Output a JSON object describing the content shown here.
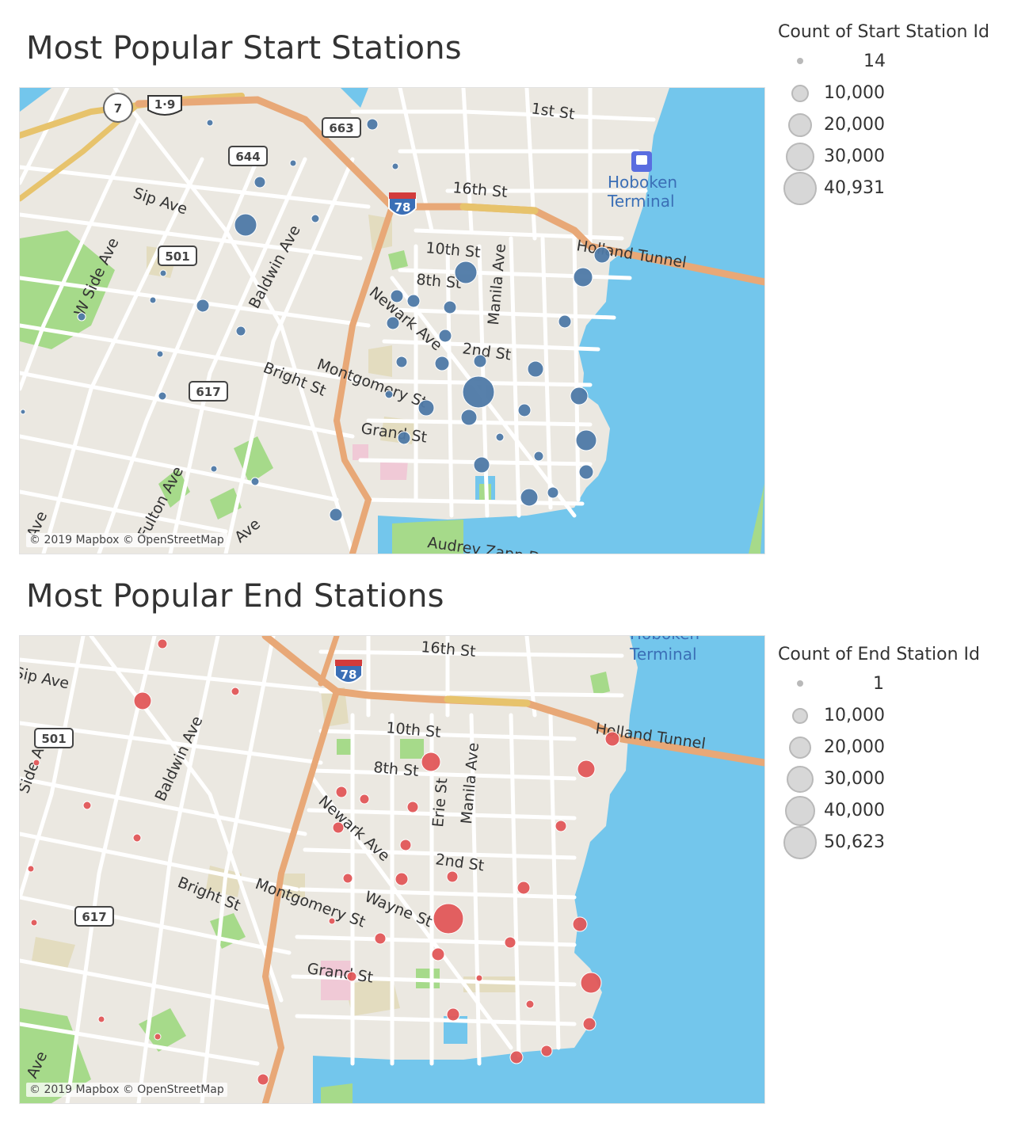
{
  "start_map": {
    "title": "Most Popular Start Stations",
    "attribution": "© 2019 Mapbox © OpenStreetMap",
    "dot_color": "#4e79a7",
    "legend": {
      "title": "Count of Start Station Id",
      "items": [
        "14",
        "10,000",
        "20,000",
        "30,000",
        "40,931"
      ]
    },
    "labels": {
      "first_st": "1st St",
      "sixteenth_st": "16th St",
      "sip_ave": "Sip Ave",
      "tenth_st": "10th St",
      "eighth_st": "8th St",
      "baldwin_ave": "Baldwin Ave",
      "manila_ave": "Manila Ave",
      "holland_tunnel": "Holland Tunnel",
      "side_ave": "W Side Ave",
      "newark_ave": "Newark Ave",
      "second_st": "2nd St",
      "bright_st": "Bright St",
      "montgomery_st": "Montgomery St",
      "grand_st": "Grand St",
      "audrey": "Audrey Zapp Dr",
      "ave_a": "Ave",
      "ave_b": "Fulton Ave",
      "ave_c": "Ave",
      "hoboken_1": "Hoboken",
      "hoboken_2": "Terminal"
    },
    "shields": {
      "s7": "7",
      "s19": "1·9",
      "s663": "663",
      "s644": "644",
      "s501": "501",
      "s617": "617",
      "s78": "78"
    }
  },
  "end_map": {
    "title": "Most Popular End Stations",
    "attribution": "© 2019 Mapbox © OpenStreetMap",
    "dot_color": "#e15759",
    "legend": {
      "title": "Count of End Station Id",
      "items": [
        "1",
        "10,000",
        "20,000",
        "30,000",
        "40,000",
        "50,623"
      ]
    },
    "labels": {
      "sip_ave": "Sip Ave",
      "sixteenth_st": "16th St",
      "tenth_st": "10th St",
      "eighth_st": "8th St",
      "baldwin_ave": "Baldwin Ave",
      "erie_st": "Erie St",
      "manila_ave": "Manila Ave",
      "holland_tunnel": "Holland Tunnel",
      "newark_ave": "Newark Ave",
      "second_st": "2nd St",
      "wayne_st": "Wayne St",
      "bright_st": "Bright St",
      "montgomery_st": "Montgomery St",
      "grand_st": "Grand St",
      "side_ave": "Side Ave",
      "ave_a": "Ave",
      "hoboken_1": "Hoboken",
      "hoboken_2": "Terminal"
    },
    "shields": {
      "s78": "78",
      "s501": "501",
      "s617": "617"
    }
  }
}
